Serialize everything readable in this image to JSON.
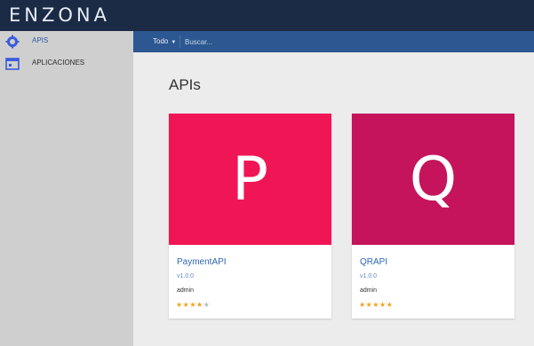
{
  "app": {
    "logo_text": "ENZONA",
    "brand_color": "#1b2b46",
    "accent_color": "#2c5790"
  },
  "sidebar": {
    "items": [
      {
        "label": "APIS",
        "icon": "gear-icon",
        "active": true
      },
      {
        "label": "APLICACIONES",
        "icon": "window-icon",
        "active": false
      }
    ]
  },
  "searchbar": {
    "filter_label": "Todo",
    "search_placeholder": "Buscar..."
  },
  "main": {
    "title": "APIs",
    "cards": [
      {
        "letter": "P",
        "name": "PaymentAPI",
        "version": "v1.0.0",
        "owner": "admin",
        "rating": 4,
        "rating_max": 5,
        "color": "#f01656"
      },
      {
        "letter": "Q",
        "name": "QRAPI",
        "version": "v1.0.0",
        "owner": "admin",
        "rating": 5,
        "rating_max": 5,
        "color": "#c5145c"
      }
    ]
  }
}
